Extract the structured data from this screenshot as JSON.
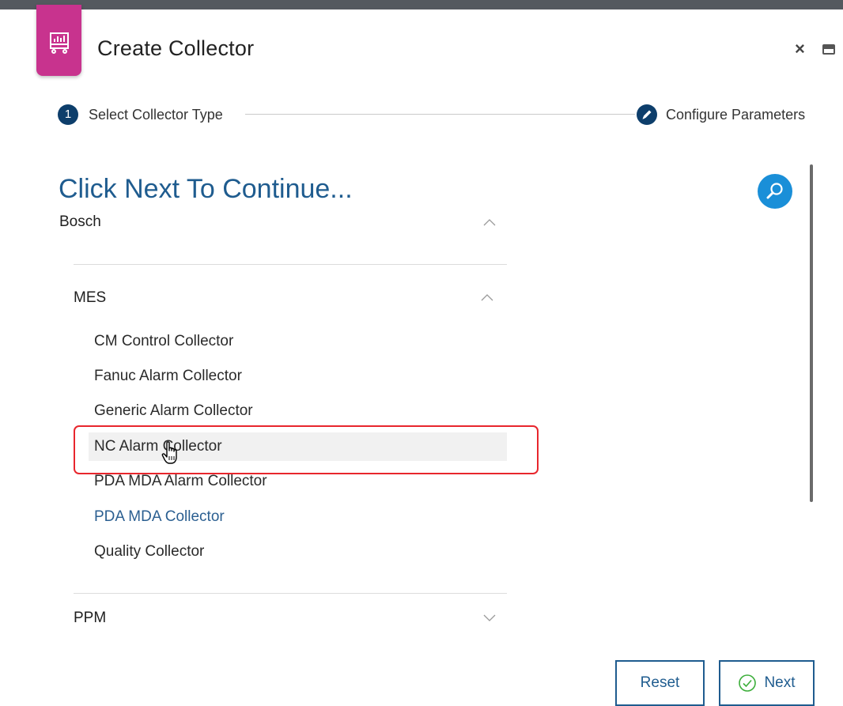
{
  "window": {
    "title": "Create Collector",
    "app_icon": "collector-cart-icon",
    "close_glyph": "×",
    "brand_color": "#c8338e"
  },
  "stepper": {
    "step1_number": "1",
    "step1_label": "Select Collector Type",
    "step2_label": "Configure Parameters",
    "step2_icon": "pencil-icon"
  },
  "main": {
    "heading": "Click Next To Continue...",
    "search_icon": "search-icon"
  },
  "tree": {
    "vendor": "Bosch",
    "groups": [
      {
        "label": "MES",
        "expanded": true,
        "items": [
          "CM Control Collector",
          "Fanuc Alarm Collector",
          "Generic Alarm Collector",
          "NC Alarm Collector",
          "PDA MDA Alarm Collector",
          "PDA MDA Collector",
          "Quality Collector"
        ]
      },
      {
        "label": "PPM",
        "expanded": false
      }
    ]
  },
  "actions": {
    "reset_label": "Reset",
    "next_label": "Next"
  },
  "colors": {
    "accent": "#1f5c8f",
    "step_fill": "#0d3e6b",
    "search_fill": "#1a8fd8",
    "highlight": "#e8262d"
  }
}
